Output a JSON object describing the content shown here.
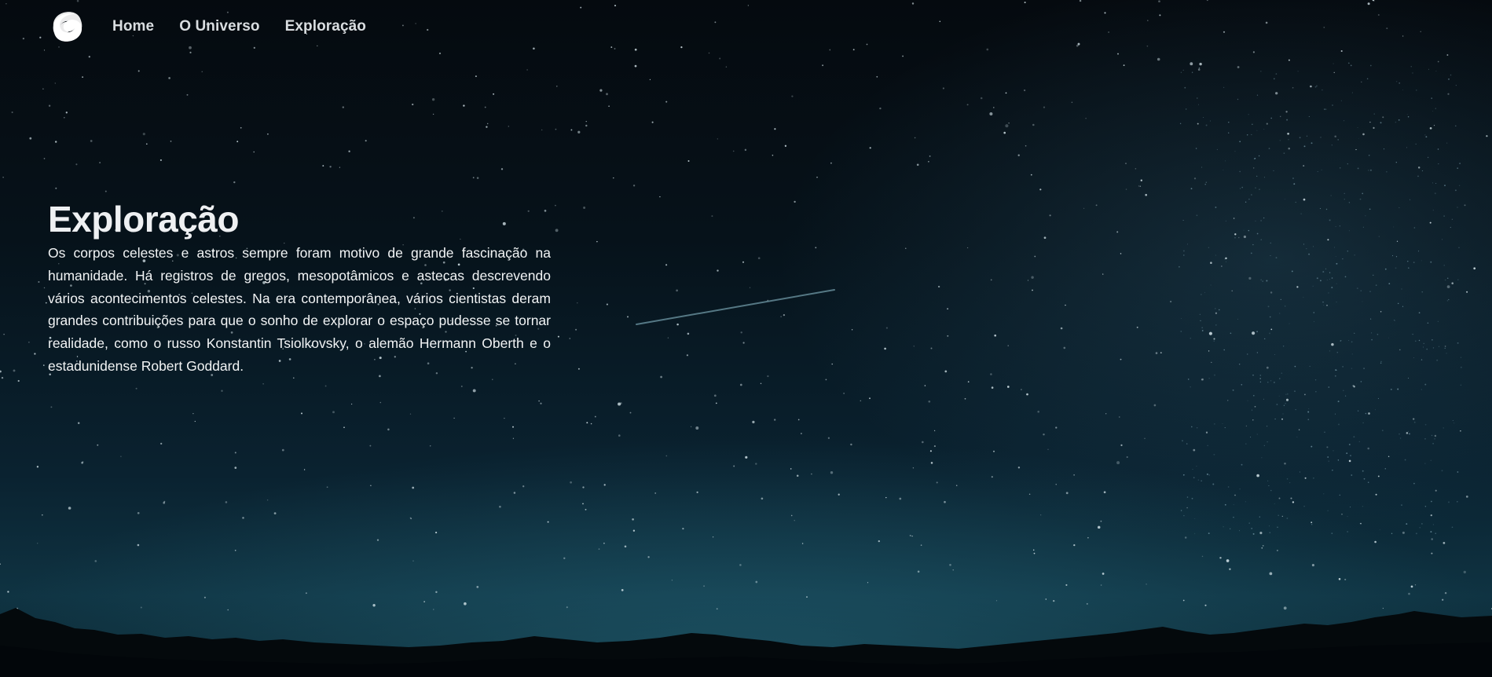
{
  "logo": {
    "icon": "swirl-logo-icon"
  },
  "nav": {
    "items": [
      {
        "label": "Home"
      },
      {
        "label": "O Universo"
      },
      {
        "label": "Exploração"
      }
    ]
  },
  "hero": {
    "title": "Exploração",
    "text": "Os corpos celestes e astros sempre foram motivo de grande fascinação na humanidade. Há registros de gregos, mesopotâmicos e astecas descrevendo vários acontecimentos celestes. Na era contemporânea, vários cientistas deram grandes contribuições para que o sonho de explorar o espaço pudesse se tornar realidade, como o russo Konstantin Tsiolkovsky, o alemão Hermann Oberth e o estadunidense Robert Goddard."
  },
  "background": {
    "scene": "night-sky-with-mountains",
    "colors": {
      "sky_top": "#050a0f",
      "sky_horizon": "#0f3342",
      "mountains": "#03080b"
    }
  }
}
